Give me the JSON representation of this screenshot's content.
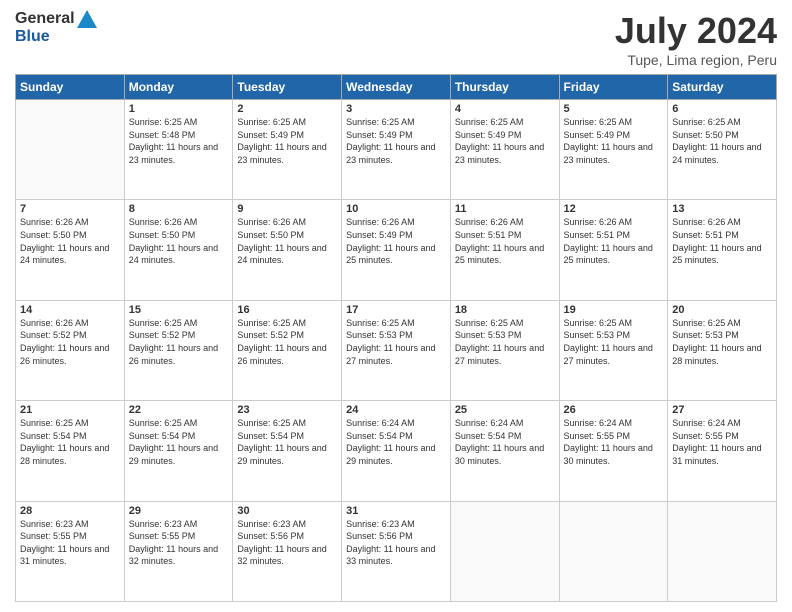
{
  "logo": {
    "general": "General",
    "blue": "Blue"
  },
  "title": "July 2024",
  "location": "Tupe, Lima region, Peru",
  "days_of_week": [
    "Sunday",
    "Monday",
    "Tuesday",
    "Wednesday",
    "Thursday",
    "Friday",
    "Saturday"
  ],
  "weeks": [
    [
      {
        "day": null,
        "info": null
      },
      {
        "day": "1",
        "sunrise": "6:25 AM",
        "sunset": "5:48 PM",
        "daylight": "11 hours and 23 minutes."
      },
      {
        "day": "2",
        "sunrise": "6:25 AM",
        "sunset": "5:49 PM",
        "daylight": "11 hours and 23 minutes."
      },
      {
        "day": "3",
        "sunrise": "6:25 AM",
        "sunset": "5:49 PM",
        "daylight": "11 hours and 23 minutes."
      },
      {
        "day": "4",
        "sunrise": "6:25 AM",
        "sunset": "5:49 PM",
        "daylight": "11 hours and 23 minutes."
      },
      {
        "day": "5",
        "sunrise": "6:25 AM",
        "sunset": "5:49 PM",
        "daylight": "11 hours and 23 minutes."
      },
      {
        "day": "6",
        "sunrise": "6:25 AM",
        "sunset": "5:50 PM",
        "daylight": "11 hours and 24 minutes."
      }
    ],
    [
      {
        "day": "7",
        "sunrise": "6:26 AM",
        "sunset": "5:50 PM",
        "daylight": "11 hours and 24 minutes."
      },
      {
        "day": "8",
        "sunrise": "6:26 AM",
        "sunset": "5:50 PM",
        "daylight": "11 hours and 24 minutes."
      },
      {
        "day": "9",
        "sunrise": "6:26 AM",
        "sunset": "5:50 PM",
        "daylight": "11 hours and 24 minutes."
      },
      {
        "day": "10",
        "sunrise": "6:26 AM",
        "sunset": "5:49 PM",
        "daylight": "11 hours and 25 minutes."
      },
      {
        "day": "11",
        "sunrise": "6:26 AM",
        "sunset": "5:51 PM",
        "daylight": "11 hours and 25 minutes."
      },
      {
        "day": "12",
        "sunrise": "6:26 AM",
        "sunset": "5:51 PM",
        "daylight": "11 hours and 25 minutes."
      },
      {
        "day": "13",
        "sunrise": "6:26 AM",
        "sunset": "5:51 PM",
        "daylight": "11 hours and 25 minutes."
      }
    ],
    [
      {
        "day": "14",
        "sunrise": "6:26 AM",
        "sunset": "5:52 PM",
        "daylight": "11 hours and 26 minutes."
      },
      {
        "day": "15",
        "sunrise": "6:25 AM",
        "sunset": "5:52 PM",
        "daylight": "11 hours and 26 minutes."
      },
      {
        "day": "16",
        "sunrise": "6:25 AM",
        "sunset": "5:52 PM",
        "daylight": "11 hours and 26 minutes."
      },
      {
        "day": "17",
        "sunrise": "6:25 AM",
        "sunset": "5:53 PM",
        "daylight": "11 hours and 27 minutes."
      },
      {
        "day": "18",
        "sunrise": "6:25 AM",
        "sunset": "5:53 PM",
        "daylight": "11 hours and 27 minutes."
      },
      {
        "day": "19",
        "sunrise": "6:25 AM",
        "sunset": "5:53 PM",
        "daylight": "11 hours and 27 minutes."
      },
      {
        "day": "20",
        "sunrise": "6:25 AM",
        "sunset": "5:53 PM",
        "daylight": "11 hours and 28 minutes."
      }
    ],
    [
      {
        "day": "21",
        "sunrise": "6:25 AM",
        "sunset": "5:54 PM",
        "daylight": "11 hours and 28 minutes."
      },
      {
        "day": "22",
        "sunrise": "6:25 AM",
        "sunset": "5:54 PM",
        "daylight": "11 hours and 29 minutes."
      },
      {
        "day": "23",
        "sunrise": "6:25 AM",
        "sunset": "5:54 PM",
        "daylight": "11 hours and 29 minutes."
      },
      {
        "day": "24",
        "sunrise": "6:24 AM",
        "sunset": "5:54 PM",
        "daylight": "11 hours and 29 minutes."
      },
      {
        "day": "25",
        "sunrise": "6:24 AM",
        "sunset": "5:54 PM",
        "daylight": "11 hours and 30 minutes."
      },
      {
        "day": "26",
        "sunrise": "6:24 AM",
        "sunset": "5:55 PM",
        "daylight": "11 hours and 30 minutes."
      },
      {
        "day": "27",
        "sunrise": "6:24 AM",
        "sunset": "5:55 PM",
        "daylight": "11 hours and 31 minutes."
      }
    ],
    [
      {
        "day": "28",
        "sunrise": "6:23 AM",
        "sunset": "5:55 PM",
        "daylight": "11 hours and 31 minutes."
      },
      {
        "day": "29",
        "sunrise": "6:23 AM",
        "sunset": "5:55 PM",
        "daylight": "11 hours and 32 minutes."
      },
      {
        "day": "30",
        "sunrise": "6:23 AM",
        "sunset": "5:56 PM",
        "daylight": "11 hours and 32 minutes."
      },
      {
        "day": "31",
        "sunrise": "6:23 AM",
        "sunset": "5:56 PM",
        "daylight": "11 hours and 33 minutes."
      },
      {
        "day": null,
        "info": null
      },
      {
        "day": null,
        "info": null
      },
      {
        "day": null,
        "info": null
      }
    ]
  ]
}
